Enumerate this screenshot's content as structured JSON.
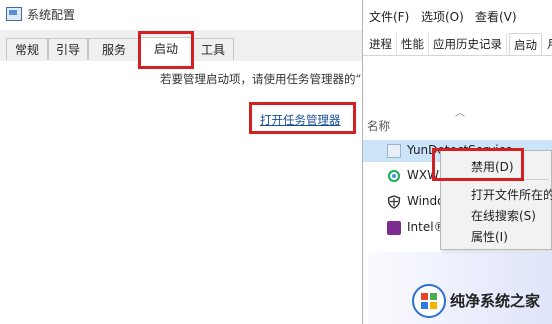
{
  "msconfig": {
    "title": "系统配置",
    "tabs": [
      "常规",
      "引导",
      "服务",
      "启动",
      "工具"
    ],
    "active_tab": "启动",
    "hint": "若要管理启动项，请使用任务管理器的“",
    "open_taskmgr_link": "打开任务管理器"
  },
  "taskmgr": {
    "menu": [
      "文件(F)",
      "选项(O)",
      "查看(V)"
    ],
    "tabs": [
      "进程",
      "性能",
      "应用历史记录",
      "启动",
      "月"
    ],
    "active_tab": "启动",
    "column_name": "名称",
    "rows": [
      {
        "name": "YunDetectService",
        "icon": "app-icon",
        "selected": true
      },
      {
        "name": "WXW",
        "icon": "wechat-icon"
      },
      {
        "name": "Windo",
        "icon": "shield-icon"
      },
      {
        "name": "Intel®",
        "icon": "intel-app-icon"
      }
    ]
  },
  "context_menu": {
    "items": [
      "禁用(D)",
      "打开文件所在的",
      "在线搜索(S)",
      "属性(I)"
    ]
  },
  "watermark": {
    "text": "纯净系统之家"
  },
  "colors": {
    "highlight": "#d32020",
    "link": "#1a4f9c",
    "selection": "#cce4f7"
  }
}
